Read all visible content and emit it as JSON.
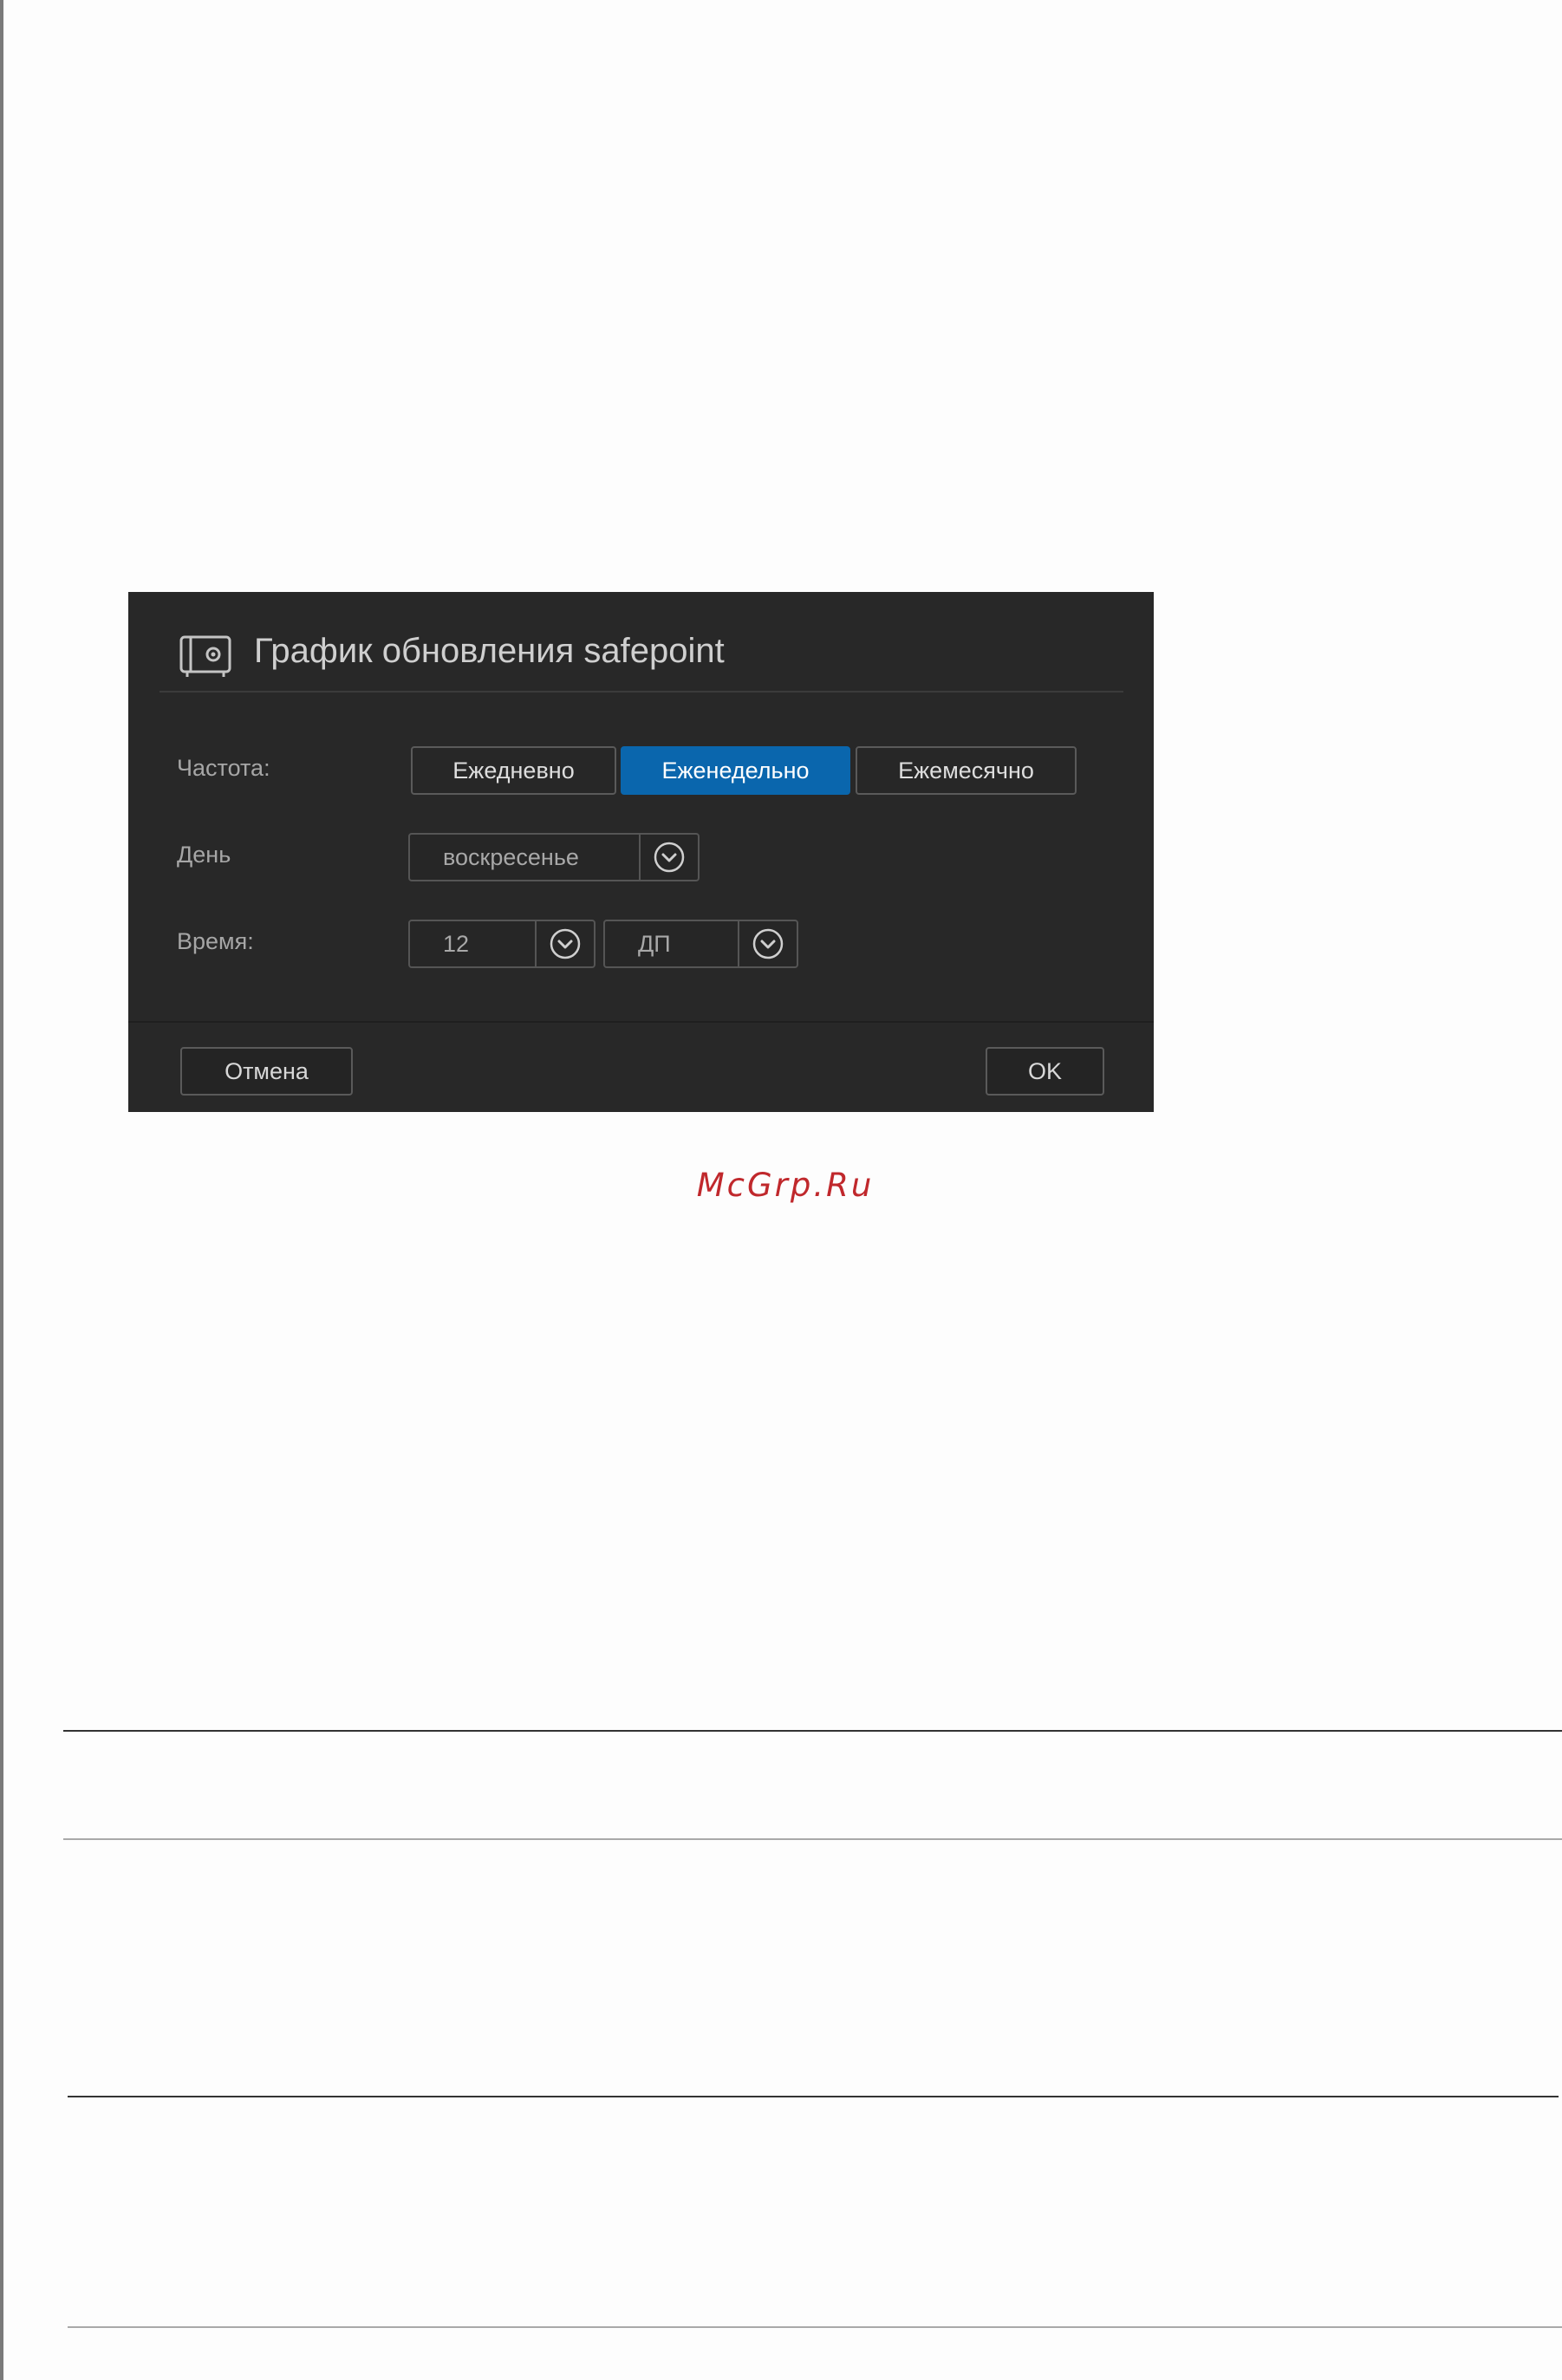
{
  "dialog": {
    "title": "График обновления safepoint",
    "icon": "safe-icon",
    "frequency": {
      "label": "Частота:",
      "options": [
        "Ежедневно",
        "Еженедельно",
        "Ежемесячно"
      ],
      "selected": "Еженедельно"
    },
    "day": {
      "label": "День",
      "value": "воскресенье"
    },
    "time": {
      "label": "Время:",
      "hour": "12",
      "period": "ДП"
    },
    "cancel_label": "Отмена",
    "ok_label": "OK"
  },
  "colors": {
    "dialog_bg": "#282828",
    "accent": "#0a66ad",
    "watermark": "#c0282c"
  },
  "watermark": {
    "text": "McGrp.Ru"
  }
}
